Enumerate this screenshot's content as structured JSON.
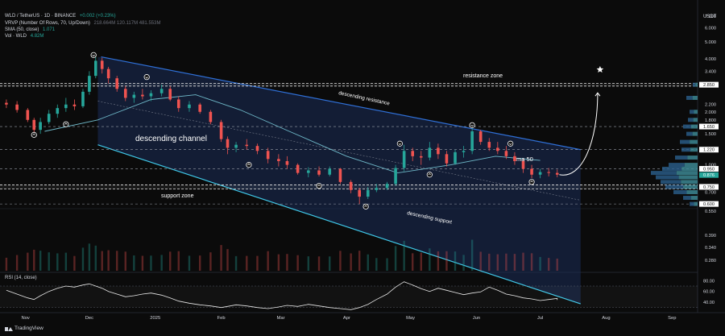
{
  "header": {
    "title": "WLD / TetherUS · 1D · BINANCE",
    "change": "+0.002 (+0.23%)",
    "vrvp_label": "VRVP (Number Of Rows, 70, Up/Down)",
    "vrvp_values": "218.664M  120.117M  481.553M",
    "sma_label": "SMA (50, close)",
    "sma_value": "1.071",
    "vol_label": "Vol · WLD",
    "vol_value": "4.82M"
  },
  "rsi_title": "RSI (14, close)",
  "currency": "USDT",
  "brand": "TradingView",
  "colors": {
    "background": "#0b0b0b",
    "up": "#26a69a",
    "down": "#ef5350",
    "channel_top": "#2f6fd6",
    "channel_bottom": "#3fc8e8",
    "channel_fill": "#1b2e5a",
    "sma": "#6fb9c9",
    "vrvp_up": "#3e8f9b",
    "vrvp_down": "#2b5f8c",
    "rsi": "#e8e8e8"
  },
  "chart_data": [
    {
      "type": "candlestick",
      "price_scale": "log",
      "ylim": [
        0.57,
        7.6
      ],
      "y_ticks": [
        "7.000",
        "6.000",
        "5.000",
        "4.000",
        "3.400",
        "2.850",
        "2.200",
        "2.000",
        "1.800",
        "1.650",
        "1.500",
        "1.220",
        "1.000",
        "0.950",
        "0.876",
        "0.750",
        "0.700",
        "0.600",
        "0.550",
        "0.390",
        "0.340",
        "0.280"
      ],
      "price_tags": [
        "2.850",
        "1.650",
        "1.220",
        "0.950",
        "0.876",
        "0.750",
        "0.600"
      ],
      "x_ticks": [
        "Nov",
        "Dec",
        "2025",
        "Feb",
        "Mar",
        "Apr",
        "May",
        "Jun",
        "Jul",
        "Aug",
        "Sep"
      ],
      "ohlc": [
        [
          "2024-10-23",
          2.25,
          2.35,
          2.1,
          2.2
        ],
        [
          "2024-10-28",
          2.2,
          2.3,
          1.98,
          2.05
        ],
        [
          "2024-11-02",
          2.05,
          2.1,
          1.75,
          1.8
        ],
        [
          "2024-11-05",
          1.8,
          1.85,
          1.48,
          1.58
        ],
        [
          "2024-11-08",
          1.58,
          1.85,
          1.5,
          1.75
        ],
        [
          "2024-11-12",
          1.75,
          2.05,
          1.7,
          1.95
        ],
        [
          "2024-11-16",
          1.95,
          2.2,
          1.85,
          2.1
        ],
        [
          "2024-11-20",
          2.1,
          2.4,
          2.0,
          2.2
        ],
        [
          "2024-11-24",
          2.2,
          2.35,
          2.05,
          2.15
        ],
        [
          "2024-11-28",
          2.15,
          2.7,
          2.1,
          2.6
        ],
        [
          "2024-12-01",
          2.6,
          3.4,
          2.5,
          3.2
        ],
        [
          "2024-12-04",
          3.2,
          4.1,
          3.1,
          3.9
        ],
        [
          "2024-12-07",
          3.9,
          4.05,
          3.3,
          3.5
        ],
        [
          "2024-12-10",
          3.5,
          3.6,
          2.9,
          3.1
        ],
        [
          "2024-12-14",
          3.1,
          3.2,
          2.6,
          2.7
        ],
        [
          "2024-12-18",
          2.7,
          2.8,
          2.3,
          2.4
        ],
        [
          "2024-12-22",
          2.4,
          2.6,
          2.25,
          2.5
        ],
        [
          "2024-12-26",
          2.5,
          2.7,
          2.35,
          2.45
        ],
        [
          "2024-12-30",
          2.45,
          2.65,
          2.3,
          2.55
        ],
        [
          "2025-01-04",
          2.55,
          2.85,
          2.45,
          2.7
        ],
        [
          "2025-01-08",
          2.7,
          2.8,
          2.3,
          2.35
        ],
        [
          "2025-01-12",
          2.35,
          2.45,
          2.0,
          2.1
        ],
        [
          "2025-01-17",
          2.1,
          2.3,
          2.0,
          2.2
        ],
        [
          "2025-01-22",
          2.2,
          2.25,
          1.95,
          2.0
        ],
        [
          "2025-01-27",
          2.0,
          2.05,
          1.7,
          1.75
        ],
        [
          "2025-02-01",
          1.75,
          1.8,
          1.35,
          1.4
        ],
        [
          "2025-02-04",
          1.4,
          1.45,
          1.15,
          1.25
        ],
        [
          "2025-02-08",
          1.25,
          1.35,
          1.18,
          1.3
        ],
        [
          "2025-02-13",
          1.3,
          1.4,
          1.22,
          1.28
        ],
        [
          "2025-02-18",
          1.28,
          1.32,
          1.15,
          1.2
        ],
        [
          "2025-02-23",
          1.2,
          1.25,
          1.02,
          1.08
        ],
        [
          "2025-02-28",
          1.08,
          1.15,
          0.98,
          1.05
        ],
        [
          "2025-03-04",
          1.05,
          1.12,
          0.95,
          1.0
        ],
        [
          "2025-03-09",
          1.0,
          1.02,
          0.88,
          0.9
        ],
        [
          "2025-03-14",
          0.9,
          0.97,
          0.85,
          0.93
        ],
        [
          "2025-03-19",
          0.93,
          0.98,
          0.86,
          0.88
        ],
        [
          "2025-03-24",
          0.88,
          0.98,
          0.86,
          0.95
        ],
        [
          "2025-03-29",
          0.95,
          0.96,
          0.78,
          0.8
        ],
        [
          "2025-04-03",
          0.8,
          0.82,
          0.69,
          0.72
        ],
        [
          "2025-04-07",
          0.72,
          0.74,
          0.6,
          0.66
        ],
        [
          "2025-04-11",
          0.66,
          0.75,
          0.64,
          0.72
        ],
        [
          "2025-04-15",
          0.72,
          0.78,
          0.7,
          0.74
        ],
        [
          "2025-04-20",
          0.74,
          0.8,
          0.72,
          0.78
        ],
        [
          "2025-04-24",
          0.78,
          1.0,
          0.76,
          0.96
        ],
        [
          "2025-04-28",
          0.96,
          1.3,
          0.92,
          1.2
        ],
        [
          "2025-05-02",
          1.2,
          1.25,
          1.05,
          1.12
        ],
        [
          "2025-05-06",
          1.12,
          1.2,
          1.0,
          1.1
        ],
        [
          "2025-05-10",
          1.1,
          1.35,
          1.06,
          1.25
        ],
        [
          "2025-05-14",
          1.25,
          1.32,
          1.08,
          1.15
        ],
        [
          "2025-05-18",
          1.15,
          1.2,
          0.98,
          1.02
        ],
        [
          "2025-05-22",
          1.02,
          1.22,
          1.0,
          1.18
        ],
        [
          "2025-05-26",
          1.18,
          1.28,
          1.1,
          1.2
        ],
        [
          "2025-05-30",
          1.2,
          1.65,
          1.15,
          1.55
        ],
        [
          "2025-06-03",
          1.55,
          1.58,
          1.3,
          1.35
        ],
        [
          "2025-06-07",
          1.35,
          1.42,
          1.2,
          1.25
        ],
        [
          "2025-06-11",
          1.25,
          1.35,
          1.15,
          1.2
        ],
        [
          "2025-06-15",
          1.2,
          1.28,
          1.08,
          1.12
        ],
        [
          "2025-06-19",
          1.12,
          1.18,
          1.0,
          1.05
        ],
        [
          "2025-06-23",
          1.05,
          1.08,
          0.9,
          0.95
        ],
        [
          "2025-06-27",
          0.95,
          1.0,
          0.84,
          0.88
        ],
        [
          "2025-07-01",
          0.88,
          0.95,
          0.84,
          0.91
        ],
        [
          "2025-07-05",
          0.91,
          0.96,
          0.86,
          0.9
        ],
        [
          "2025-07-09",
          0.9,
          0.94,
          0.85,
          0.88
        ]
      ],
      "sma50": [
        [
          "2024-11-10",
          1.55
        ],
        [
          "2024-12-05",
          1.8
        ],
        [
          "2024-12-30",
          2.35
        ],
        [
          "2025-01-20",
          2.5
        ],
        [
          "2025-02-10",
          2.05
        ],
        [
          "2025-03-05",
          1.55
        ],
        [
          "2025-04-01",
          1.12
        ],
        [
          "2025-04-25",
          0.9
        ],
        [
          "2025-05-20",
          1.0
        ],
        [
          "2025-06-10",
          1.12
        ],
        [
          "2025-07-01",
          1.06
        ]
      ],
      "channel": {
        "resistance": [
          [
            "2024-12-05",
            4.1
          ],
          [
            "2025-07-20",
            1.22
          ]
        ],
        "support": [
          [
            "2024-12-05",
            1.3
          ],
          [
            "2025-07-20",
            0.34
          ]
        ],
        "midline": [
          [
            "2024-12-05",
            2.3
          ],
          [
            "2025-07-20",
            0.63
          ]
        ]
      },
      "zones": {
        "resistance_zone": [
          2.8,
          2.9
        ],
        "support_zone": [
          0.73,
          0.77
        ]
      },
      "horizontal_levels": [
        1.65,
        1.22,
        0.95,
        0.6
      ],
      "projection": {
        "from": [
          "2025-07-10",
          0.88
        ],
        "to": [
          "2025-07-28",
          2.85
        ]
      },
      "markers": {
        "up": [
          [
            "2024-11-05",
            1.48
          ],
          [
            "2024-11-20",
            1.7
          ],
          [
            "2025-02-14",
            1.0
          ],
          [
            "2025-03-19",
            0.76
          ],
          [
            "2025-04-10",
            0.58
          ],
          [
            "2025-05-10",
            0.88
          ],
          [
            "2025-06-27",
            0.8
          ]
        ],
        "down": [
          [
            "2024-12-03",
            4.2
          ],
          [
            "2024-12-28",
            3.15
          ],
          [
            "2025-04-26",
            1.32
          ],
          [
            "2025-05-30",
            1.68
          ],
          [
            "2025-06-17",
            1.32
          ]
        ]
      },
      "annotations": [
        "resistance zone",
        "descending resistance",
        "descending channel",
        "ma 50",
        "support zone",
        "descending support"
      ]
    },
    {
      "type": "bar",
      "title": "Vol · WLD",
      "y_ticks": [
        "0.550",
        "0.390",
        "0.340",
        "0.280"
      ]
    },
    {
      "type": "line",
      "title": "RSI (14, close)",
      "ylim": [
        25,
        85
      ],
      "y_ticks": [
        "80.00",
        "60.00",
        "40.00"
      ],
      "bands": [
        30,
        70
      ],
      "values": [
        62,
        55,
        48,
        45,
        52,
        60,
        66,
        70,
        68,
        72,
        74,
        70,
        66,
        60,
        55,
        50,
        52,
        55,
        57,
        53,
        48,
        42,
        38,
        35,
        33,
        30,
        32,
        35,
        33,
        30,
        28,
        31,
        34,
        32,
        36,
        33,
        30,
        28,
        26,
        30,
        36,
        45,
        55,
        68,
        78,
        72,
        65,
        60,
        66,
        62,
        58,
        54,
        57,
        59,
        68,
        62,
        55,
        52,
        48,
        46,
        43,
        45,
        47,
        44,
        46
      ]
    }
  ]
}
